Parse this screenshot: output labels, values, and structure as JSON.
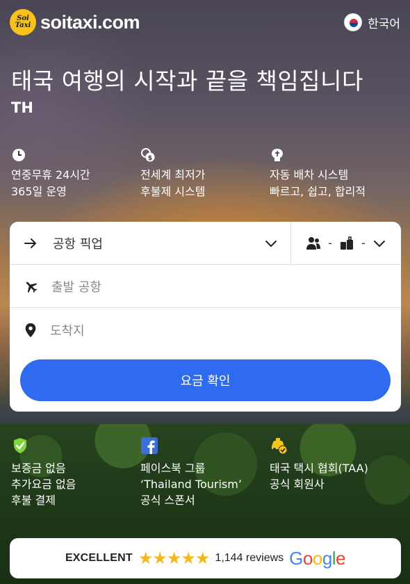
{
  "header": {
    "logo_line1": "Soi",
    "logo_line2": "Taxi",
    "site_name": "soitaxi.com",
    "language": "한국어"
  },
  "hero": {
    "title": "태국 여행의 시작과 끝을 책임집니다",
    "subtitle": "TH"
  },
  "features": [
    {
      "icon": "clock-icon",
      "line1": "연중무휴 24시간",
      "line2": "365일 운영"
    },
    {
      "icon": "money-icon",
      "line1": "전세계 최저가",
      "line2": "후불제 시스템"
    },
    {
      "icon": "brain-icon",
      "line1": "자동 배차 시스템",
      "line2": "빠르고, 쉽고, 합리적"
    }
  ],
  "booking": {
    "service_label": "공항 픽업",
    "passengers": "-",
    "luggage": "-",
    "departure_placeholder": "출발 공항",
    "destination_placeholder": "도착지",
    "cta_label": "요금 확인",
    "accent_color": "#2f6bf0"
  },
  "badges": [
    {
      "icon": "shield-check-icon",
      "line1": "보증금 없음",
      "line2": "추가요금 없음",
      "line3": "후불 결제"
    },
    {
      "icon": "facebook-icon",
      "line1": "페이스북 그룹",
      "line2": "‘Thailand Tourism’",
      "line3": "공식 스폰서"
    },
    {
      "icon": "taxi-check-icon",
      "line1": "태국 택시 협회(TAA)",
      "line2": "공식 회원사",
      "line3": ""
    }
  ],
  "reviews": {
    "rating_label": "EXCELLENT",
    "stars": "★★★★★",
    "count_label": "1,144 reviews",
    "brand": [
      "G",
      "o",
      "o",
      "g",
      "l",
      "e"
    ]
  }
}
